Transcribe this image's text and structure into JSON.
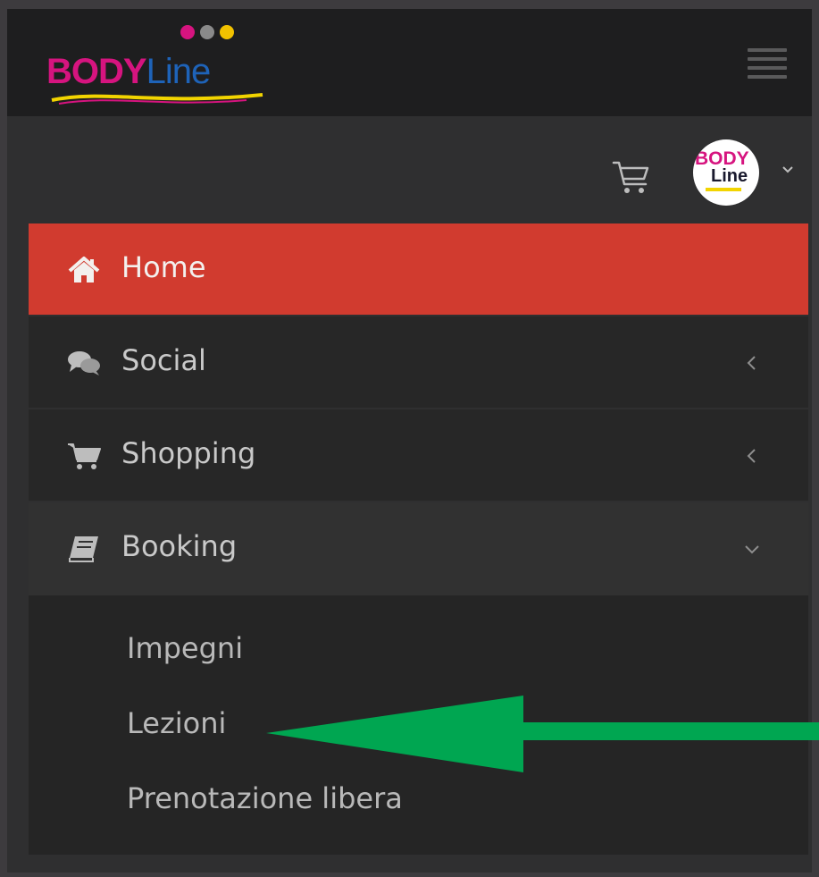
{
  "brand": {
    "logo_text_part1": "BODY",
    "logo_text_part2": "Line",
    "logo_dot_colors": [
      "#d6147f",
      "#8a8a8a",
      "#f2c200"
    ],
    "brand_pink": "#d6147f",
    "brand_blue": "#1e63b8",
    "brand_yellow": "#f2d400"
  },
  "header": {
    "menu_icon": "hamburger-icon",
    "cart_icon": "cart-icon"
  },
  "user": {
    "avatar_text_line1": "BODY",
    "avatar_text_line2": "Line",
    "dropdown_icon": "chevron-down-icon"
  },
  "menu": {
    "items": [
      {
        "label": "Home",
        "icon": "home-icon",
        "active": true,
        "chevron": null
      },
      {
        "label": "Social",
        "icon": "comments-icon",
        "active": false,
        "chevron": "chevron-left-icon"
      },
      {
        "label": "Shopping",
        "icon": "cart-icon",
        "active": false,
        "chevron": "chevron-left-icon"
      },
      {
        "label": "Booking",
        "icon": "book-icon",
        "active": false,
        "chevron": "chevron-down-icon",
        "expanded": true
      }
    ],
    "booking_submenu": [
      {
        "label": "Impegni"
      },
      {
        "label": "Lezioni"
      },
      {
        "label": "Prenotazione libera"
      }
    ]
  },
  "colors": {
    "active_item": "#d13b2f",
    "annotation_arrow": "#00a651"
  }
}
